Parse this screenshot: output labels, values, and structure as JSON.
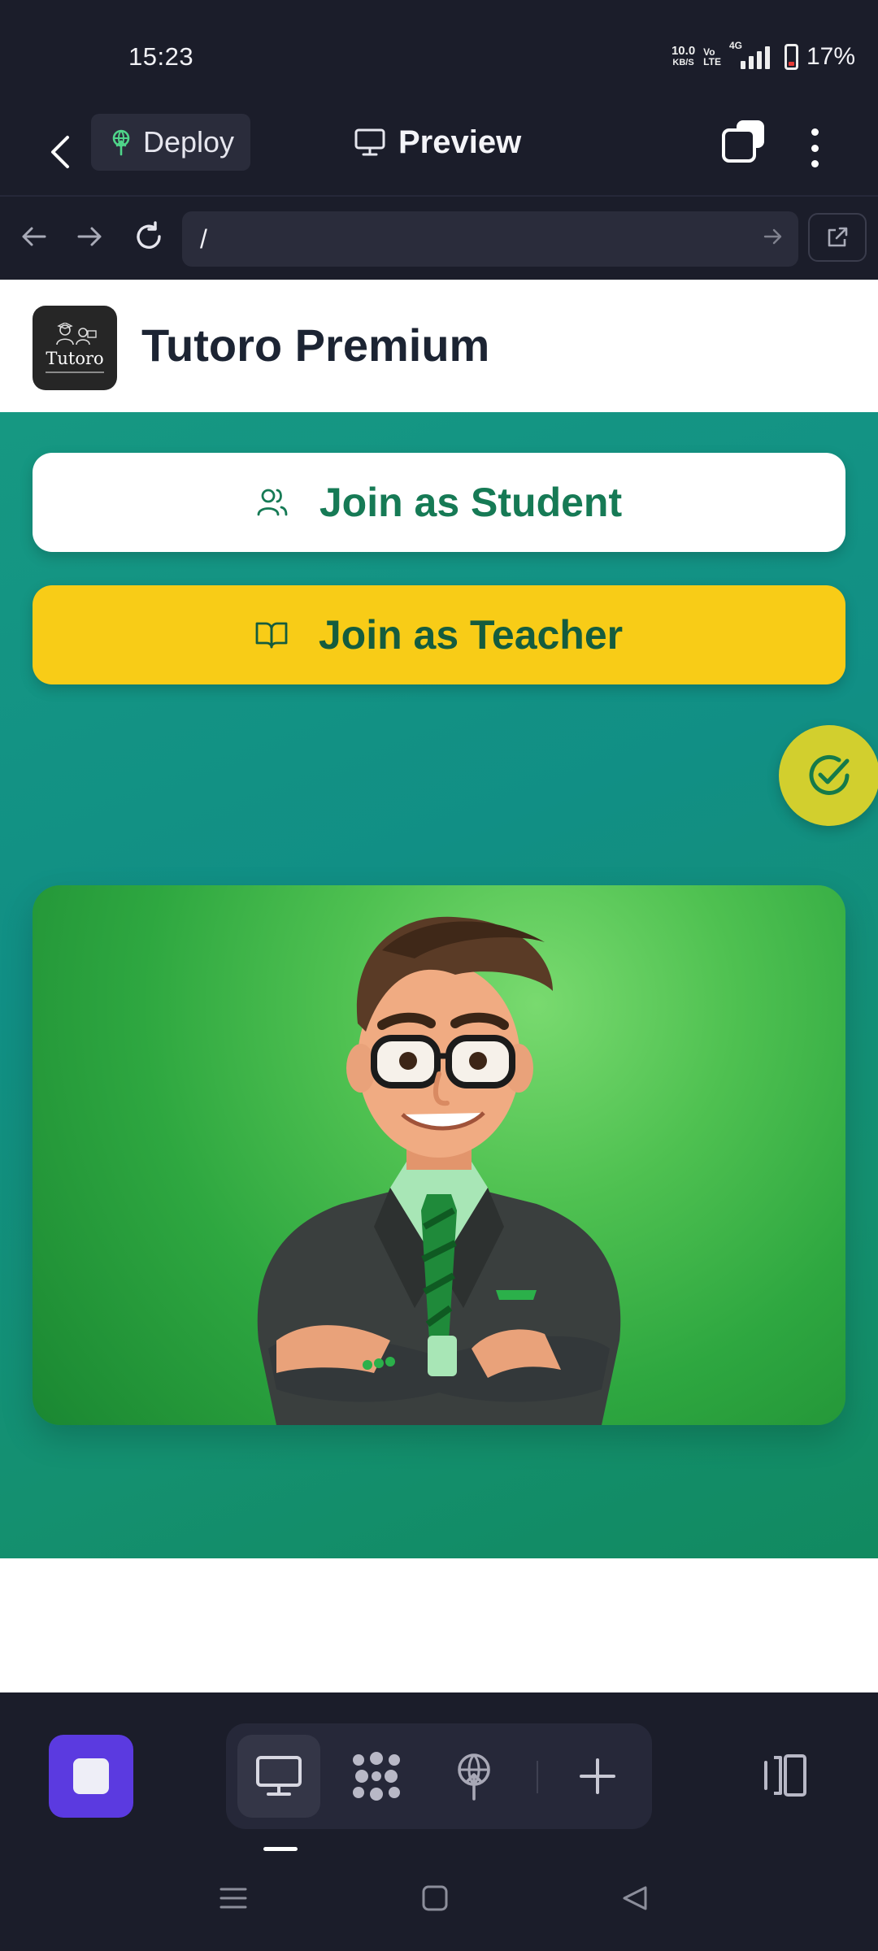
{
  "status_bar": {
    "time": "15:23",
    "net_speed_value": "10.0",
    "net_speed_unit": "KB/S",
    "volte_top": "Vo",
    "volte_bottom": "LTE",
    "network_type": "4G",
    "battery_percent": "17%"
  },
  "toolbar": {
    "deploy_label": "Deploy",
    "preview_label": "Preview"
  },
  "browser": {
    "url": "/"
  },
  "site": {
    "logo_text": "Tutoro",
    "title": "Tutoro Premium",
    "join_student_label": "Join as Student",
    "join_teacher_label": "Join as Teacher"
  },
  "colors": {
    "accent_purple": "#5b3ae0",
    "hero_green": "#118f85",
    "teacher_yellow": "#f8cc17",
    "student_text": "#167a55"
  },
  "icons": {
    "back": "chevron-left-icon",
    "deploy": "deploy-upload-icon",
    "preview": "monitor-icon",
    "student": "users-icon",
    "teacher": "book-open-icon",
    "check": "check-circle-icon"
  }
}
